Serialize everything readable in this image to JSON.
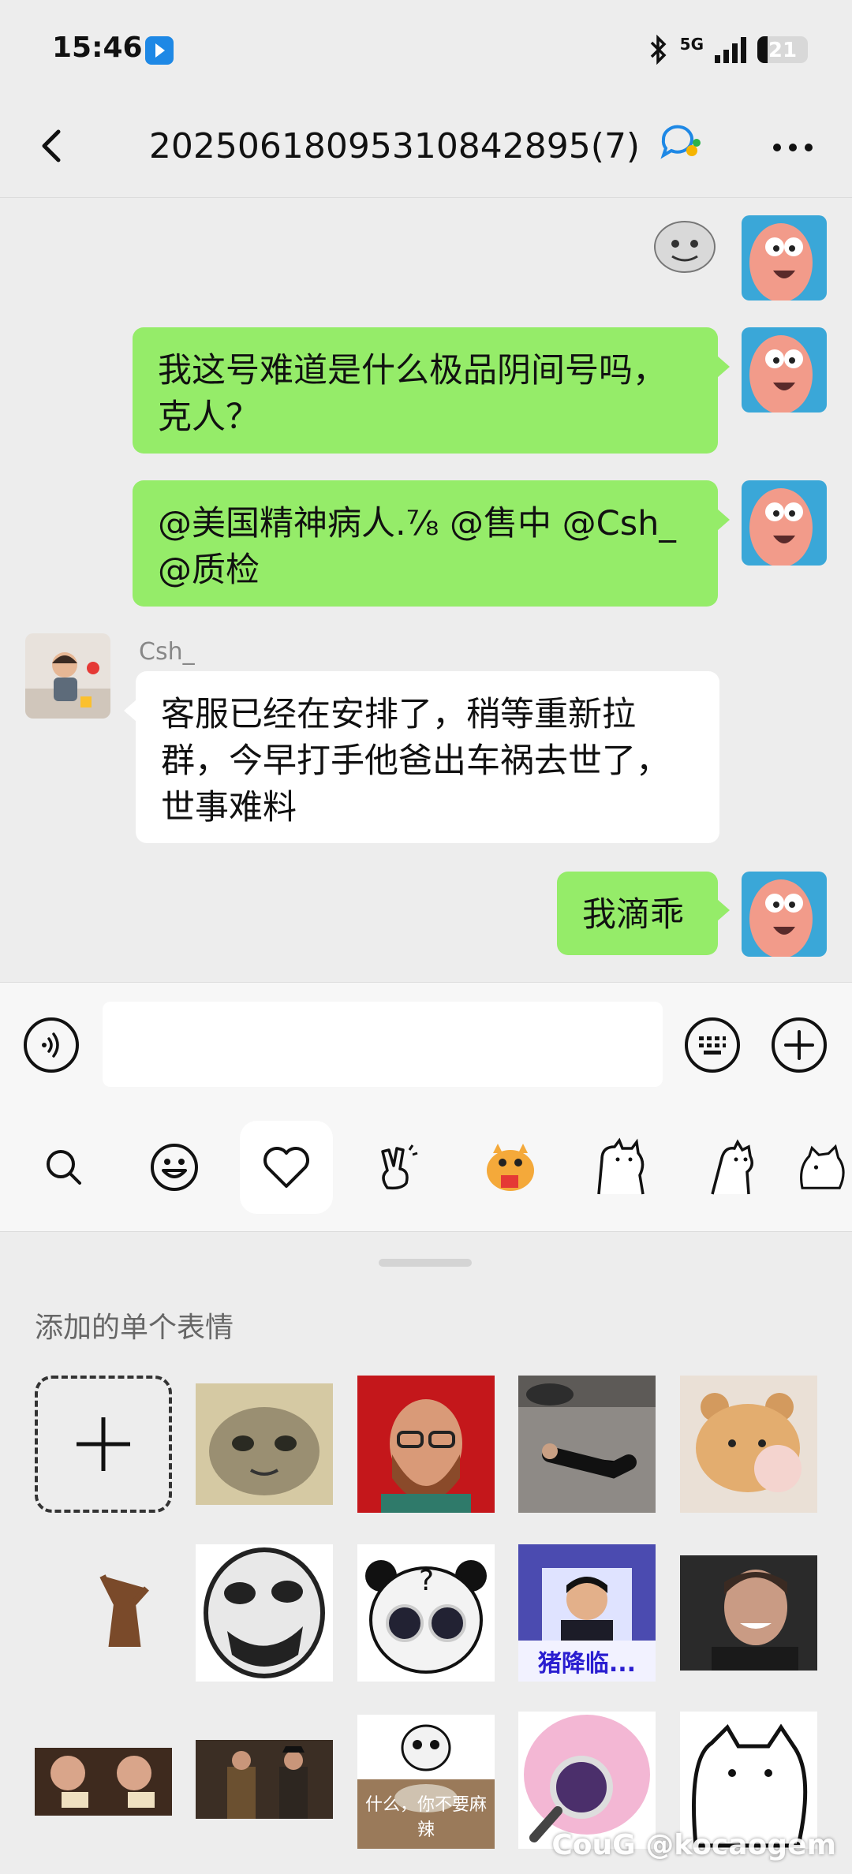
{
  "status": {
    "time": "15:46",
    "network": "5G",
    "battery": "21"
  },
  "header": {
    "title": "20250618095310842895(7)"
  },
  "messages": [
    {
      "side": "me",
      "type": "sticker"
    },
    {
      "side": "me",
      "type": "text",
      "lines": [
        "我这号难道是什么极品阴间号吗，",
        "克人？"
      ]
    },
    {
      "side": "me",
      "type": "text",
      "lines": [
        "@美国精神病人.⅞ @售中  @Csh_",
        "@质检"
      ]
    },
    {
      "side": "them",
      "sender": "Csh_",
      "type": "text",
      "lines": [
        "客服已经在安排了，稍等重新拉",
        "群，今早打手他爸出车祸去世了，",
        "世事难料"
      ]
    },
    {
      "side": "me",
      "type": "text",
      "lines": [
        "我滴乖"
      ]
    }
  ],
  "input": {
    "value": "",
    "placeholder": ""
  },
  "sticker_tabs": [
    {
      "name": "search",
      "active": false
    },
    {
      "name": "emoji",
      "active": false
    },
    {
      "name": "favorites",
      "active": true
    },
    {
      "name": "gesture",
      "active": false
    },
    {
      "name": "dragon",
      "active": false
    },
    {
      "name": "cat-1",
      "active": false
    },
    {
      "name": "cat-2",
      "active": false
    },
    {
      "name": "cat-3",
      "active": false
    }
  ],
  "panel": {
    "title": "添加的单个表情",
    "sticker_captions": {
      "r2c4": "猪降临...",
      "r3c3": "什么，你不要麻辣"
    },
    "watermark": "CouG @kocaogem"
  },
  "colors": {
    "me_bubble": "#95ec69",
    "them_bubble": "#ffffff",
    "background": "#ededed"
  }
}
